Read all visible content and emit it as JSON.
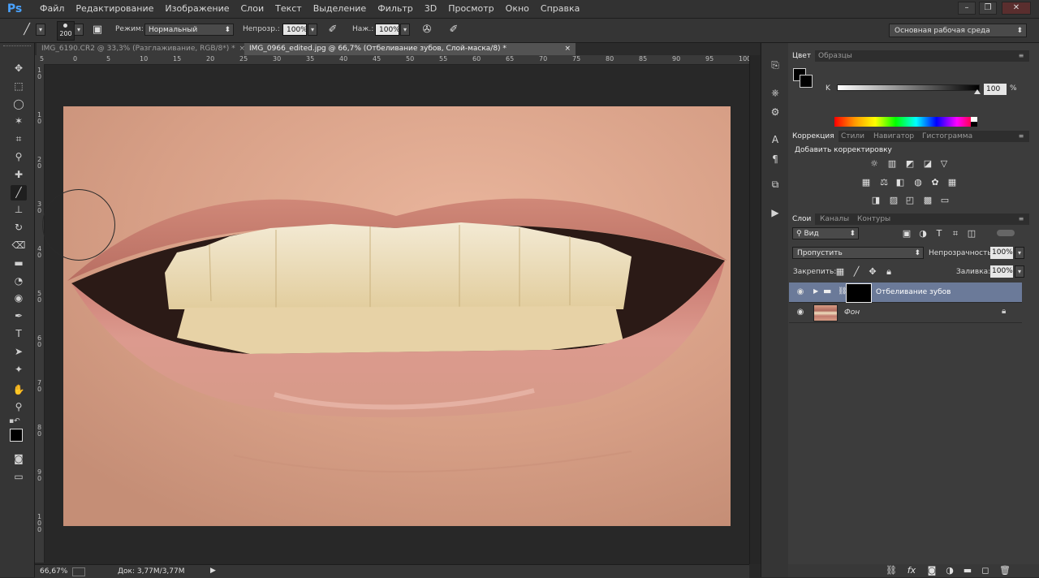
{
  "app": {
    "logo": "Ps"
  },
  "menu": [
    "Файл",
    "Редактирование",
    "Изображение",
    "Слои",
    "Текст",
    "Выделение",
    "Фильтр",
    "3D",
    "Просмотр",
    "Окно",
    "Справка"
  ],
  "window_controls": {
    "minimize": "–",
    "restore": "❐",
    "close": "✕"
  },
  "options": {
    "brush_size": "200",
    "mode_label": "Режим:",
    "mode_value": "Нормальный",
    "opacity_label": "Непрозр.:",
    "opacity_value": "100%",
    "pressure_label": "Наж.:",
    "pressure_value": "100%",
    "workspace": "Основная рабочая среда"
  },
  "tabs": [
    {
      "label": "IMG_6190.CR2 @ 33,3% (Разглаживание, RGB/8*) *",
      "close": "×"
    },
    {
      "label": "IMG_0966_edited.jpg @ 66,7% (Отбеливание зубов, Слой-маска/8) *",
      "close": "×"
    }
  ],
  "ruler_h": [
    "5",
    "0",
    "5",
    "10",
    "15",
    "20",
    "25",
    "30",
    "35",
    "40",
    "45",
    "50",
    "55",
    "60",
    "65",
    "70",
    "75",
    "80",
    "85",
    "90",
    "95",
    "100"
  ],
  "ruler_v": [
    [
      "1",
      "0"
    ],
    [
      "1",
      "0"
    ],
    [
      "2",
      "0"
    ],
    [
      "3",
      "0"
    ],
    [
      "4",
      "0"
    ],
    [
      "5",
      "0"
    ],
    [
      "6",
      "0"
    ],
    [
      "7",
      "0"
    ],
    [
      "8",
      "0"
    ],
    [
      "9",
      "0"
    ],
    [
      "1",
      "0",
      "0"
    ]
  ],
  "status": {
    "zoom": "66,67%",
    "doc": "Док: 3,77M/3,77M",
    "arrow": "▶"
  },
  "color_panel": {
    "tabs": [
      "Цвет",
      "Образцы"
    ],
    "channel": "K",
    "value": "100",
    "unit": "%"
  },
  "adjust_panel": {
    "tabs": [
      "Коррекция",
      "Стили",
      "Навигатор",
      "Гистограмма"
    ],
    "title": "Добавить корректировку"
  },
  "layers_panel": {
    "tabs": [
      "Слои",
      "Каналы",
      "Контуры"
    ],
    "filter": "Вид",
    "blend": "Пропустить",
    "opacity_label": "Непрозрачность:",
    "opacity_value": "100%",
    "lock_label": "Закрепить:",
    "fill_label": "Заливка:",
    "fill_value": "100%",
    "layers": [
      {
        "name": "Отбеливание зубов",
        "type": "group",
        "selected": true
      },
      {
        "name": "Фон",
        "type": "background",
        "selected": false
      }
    ]
  },
  "colors": {
    "accent": "#4aa3ff",
    "selected_layer": "#6b7a99"
  }
}
